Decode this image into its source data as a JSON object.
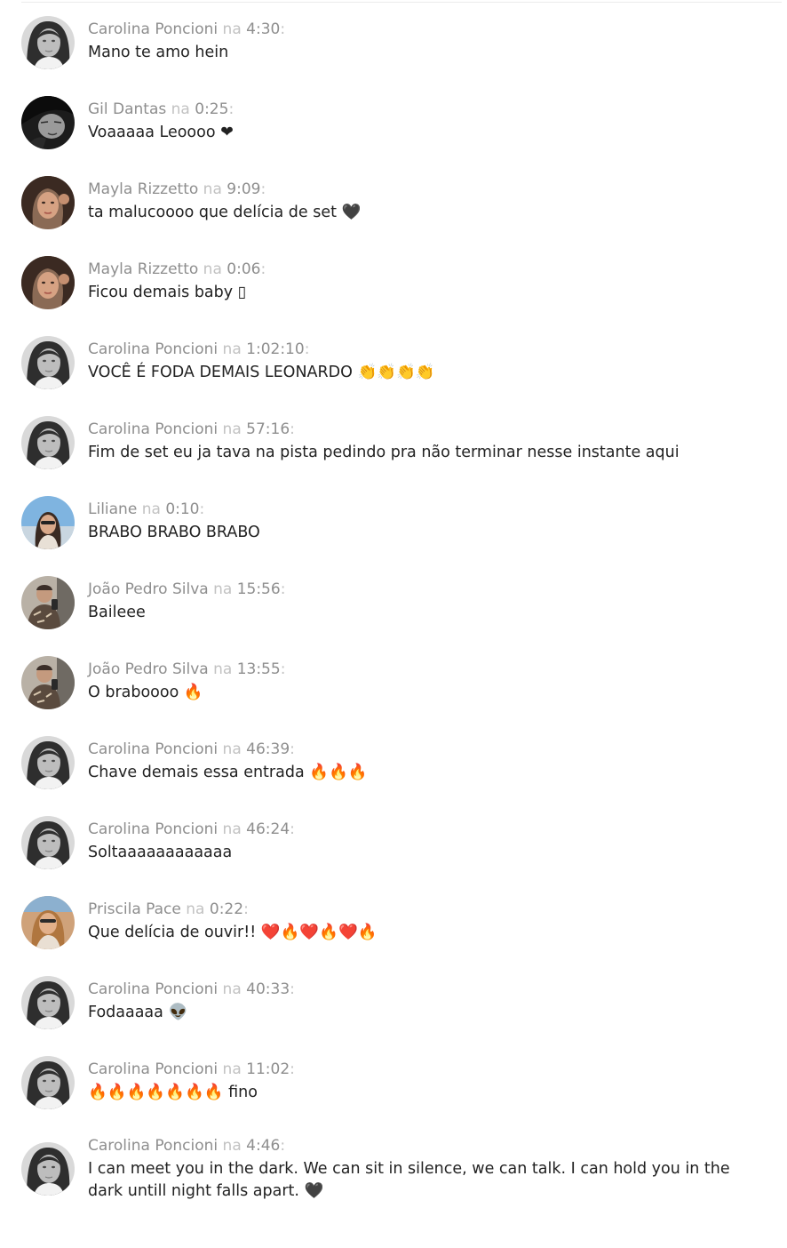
{
  "comments": [
    {
      "author": "Carolina Poncioni",
      "sep": "na",
      "time": "4:30",
      "colon": ":",
      "text": "Mano te amo hein",
      "avatar": "carolina"
    },
    {
      "author": "Gil Dantas",
      "sep": "na",
      "time": "0:25",
      "colon": ":",
      "text": "Voaaaaa Leoooo ❤",
      "avatar": "gil"
    },
    {
      "author": "Mayla Rizzetto",
      "sep": "na",
      "time": "9:09",
      "colon": ":",
      "text": "ta malucoooo que delícia de set 🖤",
      "avatar": "mayla"
    },
    {
      "author": "Mayla Rizzetto",
      "sep": "na",
      "time": "0:06",
      "colon": ":",
      "text": "Ficou demais baby ▯",
      "avatar": "mayla"
    },
    {
      "author": "Carolina Poncioni",
      "sep": "na",
      "time": "1:02:10",
      "colon": ":",
      "text": "VOCÊ É FODA DEMAIS LEONARDO 👏👏👏👏",
      "avatar": "carolina"
    },
    {
      "author": "Carolina Poncioni",
      "sep": "na",
      "time": "57:16",
      "colon": ":",
      "text": "Fim de set eu ja tava na pista pedindo pra não terminar nesse instante aqui",
      "avatar": "carolina"
    },
    {
      "author": "Liliane",
      "sep": "na",
      "time": "0:10",
      "colon": ":",
      "text": "BRABO BRABO BRABO",
      "avatar": "liliane"
    },
    {
      "author": "João Pedro Silva",
      "sep": "na",
      "time": "15:56",
      "colon": ":",
      "text": "Baileee",
      "avatar": "joao"
    },
    {
      "author": "João Pedro Silva",
      "sep": "na",
      "time": "13:55",
      "colon": ":",
      "text": "O braboooo 🔥",
      "avatar": "joao"
    },
    {
      "author": "Carolina Poncioni",
      "sep": "na",
      "time": "46:39",
      "colon": ":",
      "text": "Chave demais essa entrada 🔥🔥🔥",
      "avatar": "carolina"
    },
    {
      "author": "Carolina Poncioni",
      "sep": "na",
      "time": "46:24",
      "colon": ":",
      "text": "Soltaaaaaaaaaaaa",
      "avatar": "carolina"
    },
    {
      "author": "Priscila Pace",
      "sep": "na",
      "time": "0:22",
      "colon": ":",
      "text": "Que delícia de ouvir!! ❤️🔥❤️🔥❤️🔥",
      "avatar": "priscila"
    },
    {
      "author": "Carolina Poncioni",
      "sep": "na",
      "time": "40:33",
      "colon": ":",
      "text": "Fodaaaaa 👽",
      "avatar": "carolina"
    },
    {
      "author": "Carolina Poncioni",
      "sep": "na",
      "time": "11:02",
      "colon": ":",
      "text": "🔥🔥🔥🔥🔥🔥🔥 fino",
      "avatar": "carolina"
    },
    {
      "author": "Carolina Poncioni",
      "sep": "na",
      "time": "4:46",
      "colon": ":",
      "text": "I can meet you in the dark. We can sit in silence, we can talk. I can hold you in the dark untill night falls apart. 🖤",
      "avatar": "carolina"
    }
  ]
}
